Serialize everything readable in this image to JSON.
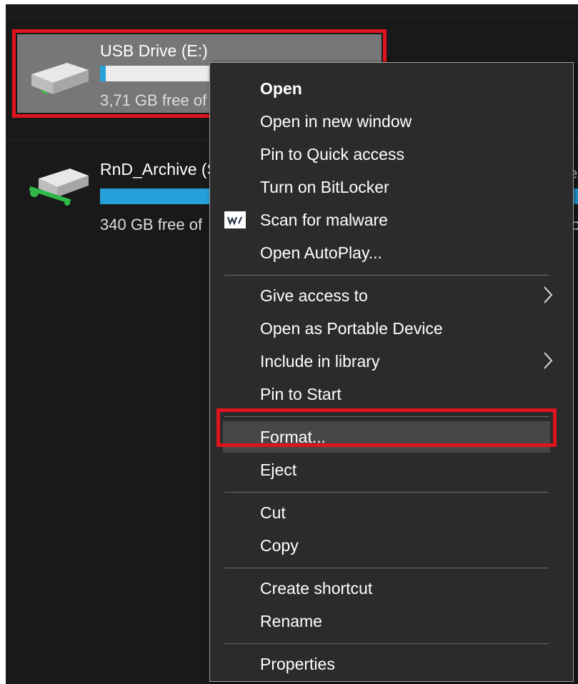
{
  "drives": [
    {
      "name": "USB Drive (E:)",
      "free_text": "3,71 GB free of",
      "usage_fraction": 0.02
    },
    {
      "name": "RnD_Archive (S",
      "free_text": "340 GB free of",
      "usage_fraction": 1.0
    }
  ],
  "menu": {
    "groups": [
      [
        {
          "label": "Open",
          "bold": true
        },
        {
          "label": "Open in new window"
        },
        {
          "label": "Pin to Quick access"
        },
        {
          "label": "Turn on BitLocker"
        },
        {
          "label": "Scan for malware",
          "icon": "malwarebytes-icon"
        },
        {
          "label": "Open AutoPlay..."
        }
      ],
      [
        {
          "label": "Give access to",
          "submenu": true
        },
        {
          "label": "Open as Portable Device"
        },
        {
          "label": "Include in library",
          "submenu": true
        },
        {
          "label": "Pin to Start"
        }
      ],
      [
        {
          "label": "Format...",
          "highlighted": true
        },
        {
          "label": "Eject"
        }
      ],
      [
        {
          "label": "Cut"
        },
        {
          "label": "Copy"
        }
      ],
      [
        {
          "label": "Create shortcut"
        },
        {
          "label": "Rename"
        }
      ],
      [
        {
          "label": "Properties"
        }
      ]
    ]
  },
  "edge_fragments": [
    "e",
    "c"
  ],
  "colors": {
    "background": "#191919",
    "menu_background": "#2b2b2b",
    "selection": "#777777",
    "highlight_outline": "#e0141e",
    "progress_blue": "#26a0da"
  }
}
